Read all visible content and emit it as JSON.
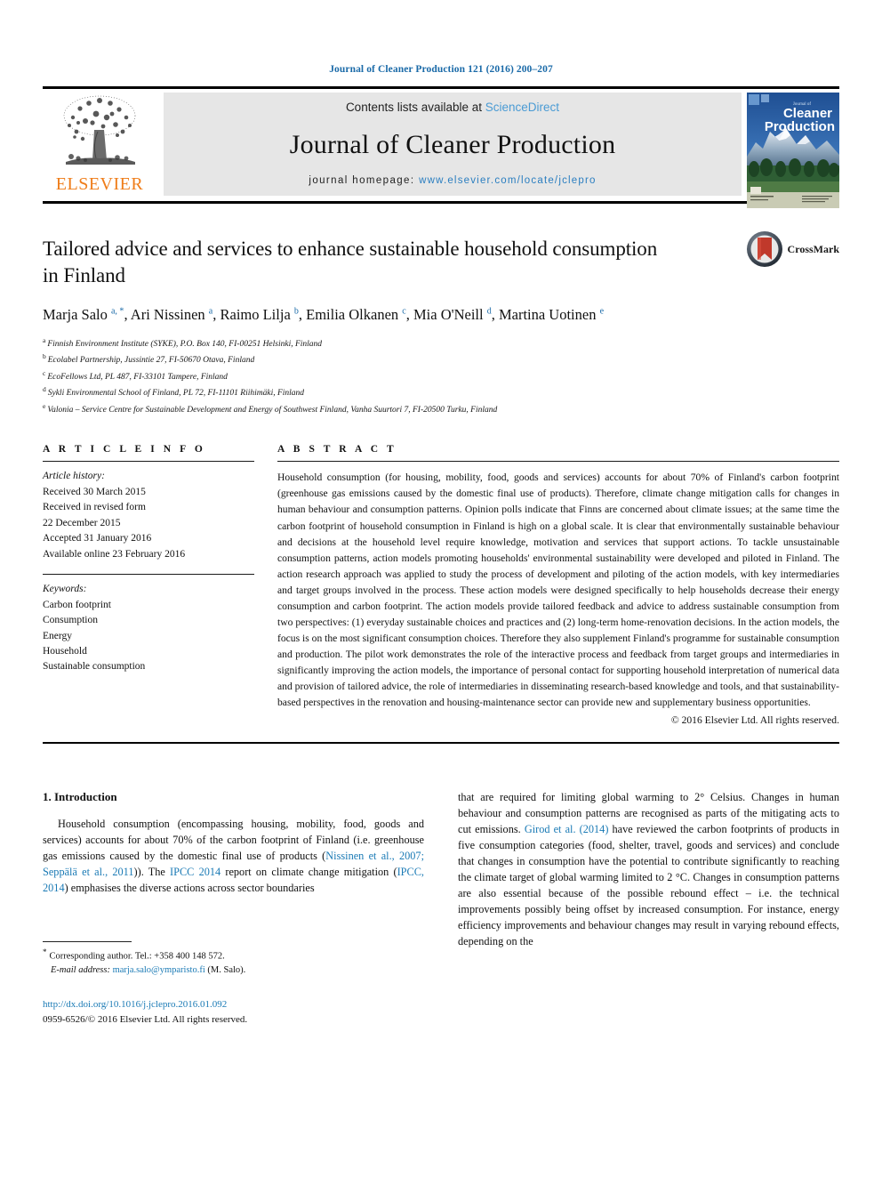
{
  "running_head": "Journal of Cleaner Production 121 (2016) 200–207",
  "masthead": {
    "publisher_name": "ELSEVIER",
    "contents_prefix": "Contents lists available at ",
    "contents_link": "ScienceDirect",
    "journal_name": "Journal of Cleaner Production",
    "homepage_prefix": "journal homepage: ",
    "homepage_url": "www.elsevier.com/locate/jclepro",
    "cover_title_small": "Journal of",
    "cover_title_line1": "Cleaner",
    "cover_title_line2": "Production"
  },
  "article": {
    "title": "Tailored advice and services to enhance sustainable household consumption in Finland",
    "crossmark_label": "CrossMark",
    "authors_html": "Marja Salo <sup>a, *</sup>, Ari Nissinen <sup>a</sup>, Raimo Lilja <sup>b</sup>, Emilia Olkanen <sup>c</sup>, Mia O'Neill <sup>d</sup>, Martina Uotinen <sup>e</sup>",
    "affiliations": [
      {
        "marker": "a",
        "text": "Finnish Environment Institute (SYKE), P.O. Box 140, FI-00251 Helsinki, Finland"
      },
      {
        "marker": "b",
        "text": "Ecolabel Partnership, Jussintie 27, FI-50670 Otava, Finland"
      },
      {
        "marker": "c",
        "text": "EcoFellows Ltd, PL 487, FI-33101 Tampere, Finland"
      },
      {
        "marker": "d",
        "text": "Sykli Environmental School of Finland, PL 72, FI-11101 Riihimäki, Finland"
      },
      {
        "marker": "e",
        "text": "Valonia – Service Centre for Sustainable Development and Energy of Southwest Finland, Vanha Suurtori 7, FI-20500 Turku, Finland"
      }
    ]
  },
  "article_info": {
    "heading": "A R T I C L E  I N F O",
    "history_label": "Article history:",
    "history": [
      "Received 30 March 2015",
      "Received in revised form",
      "22 December 2015",
      "Accepted 31 January 2016",
      "Available online 23 February 2016"
    ],
    "keywords_label": "Keywords:",
    "keywords": [
      "Carbon footprint",
      "Consumption",
      "Energy",
      "Household",
      "Sustainable consumption"
    ]
  },
  "abstract": {
    "heading": "A B S T R A C T",
    "text": "Household consumption (for housing, mobility, food, goods and services) accounts for about 70% of Finland's carbon footprint (greenhouse gas emissions caused by the domestic final use of products). Therefore, climate change mitigation calls for changes in human behaviour and consumption patterns. Opinion polls indicate that Finns are concerned about climate issues; at the same time the carbon footprint of household consumption in Finland is high on a global scale. It is clear that environmentally sustainable behaviour and decisions at the household level require knowledge, motivation and services that support actions. To tackle unsustainable consumption patterns, action models promoting households' environmental sustainability were developed and piloted in Finland. The action research approach was applied to study the process of development and piloting of the action models, with key intermediaries and target groups involved in the process. These action models were designed specifically to help households decrease their energy consumption and carbon footprint. The action models provide tailored feedback and advice to address sustainable consumption from two perspectives: (1) everyday sustainable choices and practices and (2) long-term home-renovation decisions. In the action models, the focus is on the most significant consumption choices. Therefore they also supplement Finland's programme for sustainable consumption and production. The pilot work demonstrates the role of the interactive process and feedback from target groups and intermediaries in significantly improving the action models, the importance of personal contact for supporting household interpretation of numerical data and provision of tailored advice, the role of intermediaries in disseminating research-based knowledge and tools, and that sustainability-based perspectives in the renovation and housing-maintenance sector can provide new and supplementary business opportunities.",
    "copyright": "© 2016 Elsevier Ltd. All rights reserved."
  },
  "body": {
    "section_heading": "1. Introduction",
    "left_paragraph_html": "Household consumption (encompassing housing, mobility, food, goods and services) accounts for about 70% of the carbon footprint of Finland (i.e. greenhouse gas emissions caused by the domestic final use of products (<span class=\"cite\">Nissinen et al., 2007; Seppälä et al., 2011</span>)). The <span class=\"cite\">IPCC 2014</span> report on climate change mitigation (<span class=\"cite\">IPCC, 2014</span>) emphasises the diverse actions across sector boundaries",
    "right_paragraph_html": "that are required for limiting global warming to 2° Celsius. Changes in human behaviour and consumption patterns are recognised as parts of the mitigating acts to cut emissions. <span class=\"cite\">Girod et al. (2014)</span> have reviewed the carbon footprints of products in five consumption categories (food, shelter, travel, goods and services) and conclude that changes in consumption have the potential to contribute significantly to reaching the climate target of global warming limited to 2 °C. Changes in consumption patterns are also essential because of the possible rebound effect – i.e. the technical improvements possibly being offset by increased consumption. For instance, energy efficiency improvements and behaviour changes may result in varying rebound effects, depending on the"
  },
  "footer": {
    "corresponding_star": "*",
    "corresponding_text": "Corresponding author. Tel.: +358 400 148 572.",
    "email_label": "E-mail address:",
    "email": "marja.salo@ymparisto.fi",
    "email_suffix": "(M. Salo).",
    "doi": "http://dx.doi.org/10.1016/j.jclepro.2016.01.092",
    "issn_line": "0959-6526/© 2016 Elsevier Ltd. All rights reserved."
  },
  "colors": {
    "link_blue": "#1a7ab5",
    "header_blue": "#1a6aa8",
    "elsevier_orange": "#ef7d1a",
    "masthead_grey": "#e6e6e6"
  }
}
